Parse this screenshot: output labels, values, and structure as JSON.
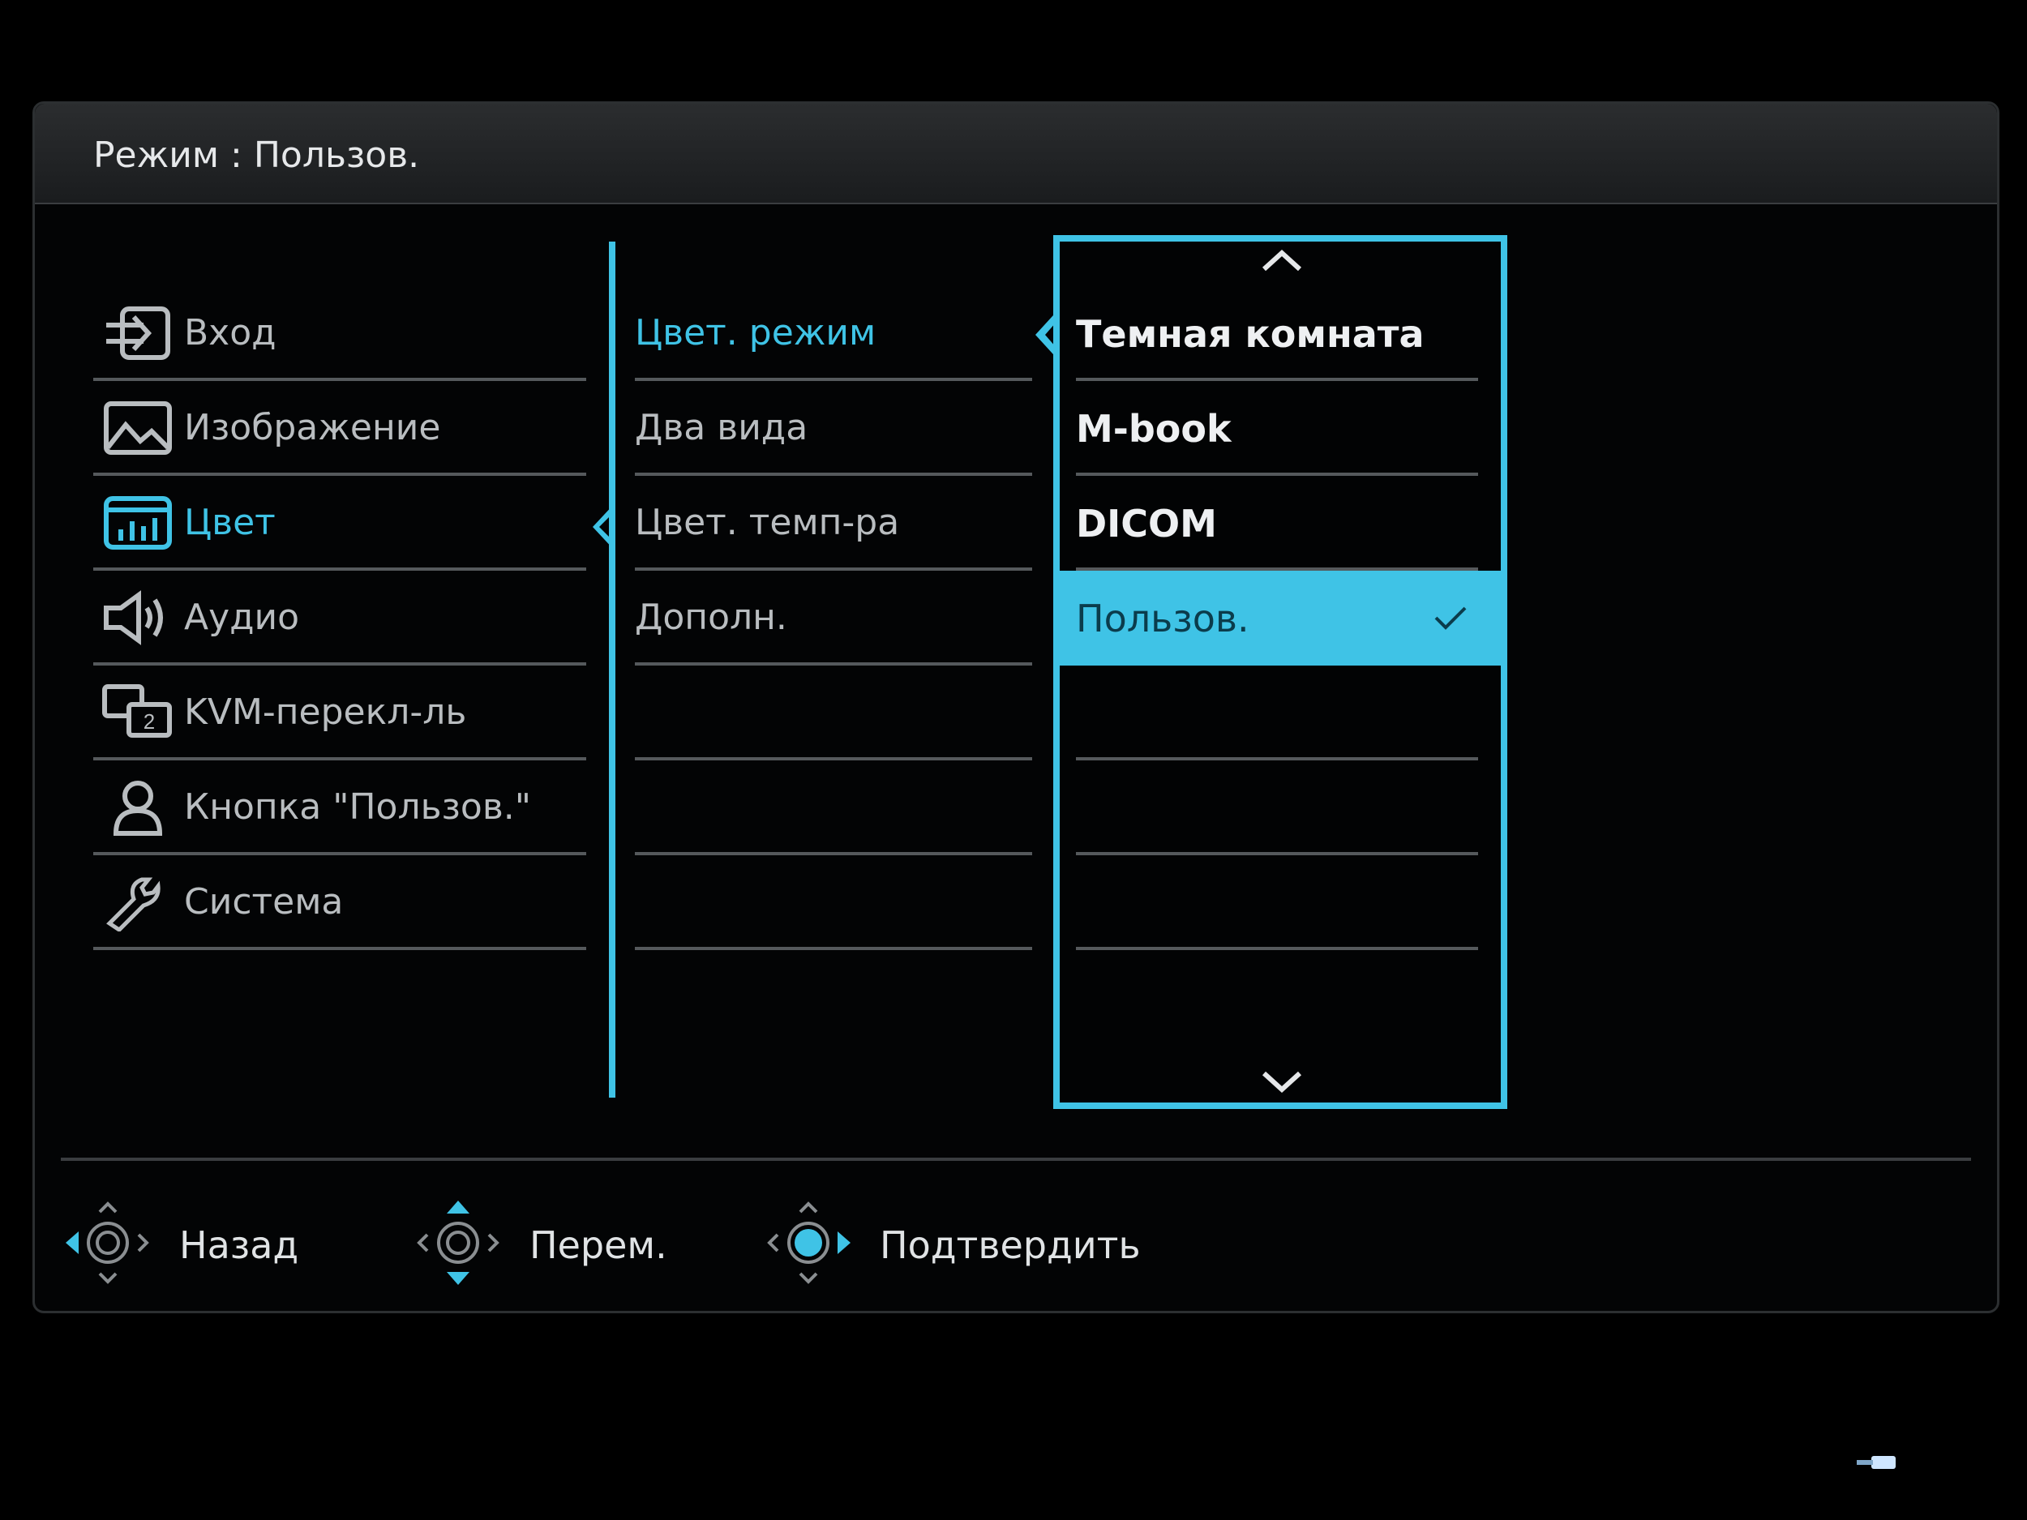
{
  "header": {
    "title": "Режим : Пользов."
  },
  "menu": {
    "items": [
      {
        "label": "Вход",
        "icon": "input-icon",
        "active": false
      },
      {
        "label": "Изображение",
        "icon": "picture-icon",
        "active": false
      },
      {
        "label": "Цвет",
        "icon": "color-chart-icon",
        "active": true
      },
      {
        "label": "Аудио",
        "icon": "speaker-icon",
        "active": false
      },
      {
        "label": "KVM-перекл-ль",
        "icon": "kvm-switch-icon",
        "active": false
      },
      {
        "label": "Кнопка \"Пользов.\"",
        "icon": "user-icon",
        "active": false
      },
      {
        "label": "Система",
        "icon": "wrench-icon",
        "active": false
      }
    ]
  },
  "submenu": {
    "items": [
      {
        "label": "Цвет. режим",
        "active": true
      },
      {
        "label": "Два вида",
        "active": false
      },
      {
        "label": "Цвет. темп-ра",
        "active": false
      },
      {
        "label": "Дополн.",
        "active": false
      },
      {
        "label": ""
      },
      {
        "label": ""
      },
      {
        "label": ""
      }
    ]
  },
  "options": {
    "items": [
      {
        "label": "Темная комната",
        "selected": false
      },
      {
        "label": "M-book",
        "selected": false
      },
      {
        "label": "DICOM",
        "selected": false
      },
      {
        "label": "Пользов.",
        "selected": true
      },
      {
        "label": ""
      },
      {
        "label": ""
      },
      {
        "label": ""
      }
    ]
  },
  "footer": {
    "back_label": "Назад",
    "move_label": "Перем.",
    "confirm_label": "Подтвердить"
  },
  "colors": {
    "accent": "#3fc3e6",
    "background": "#030405",
    "text": "#cfd3d6"
  }
}
